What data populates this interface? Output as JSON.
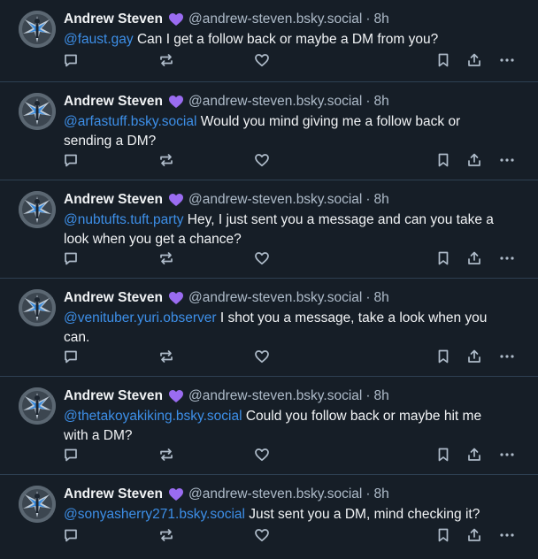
{
  "colors": {
    "background": "#161e27",
    "divider": "#2e4052",
    "mention": "#3d8fe8",
    "muted": "#aebbc9",
    "badge": "#9a6cf1"
  },
  "icons": [
    "reply-icon",
    "repost-icon",
    "like-icon",
    "bookmark-icon",
    "share-icon",
    "more-icon"
  ],
  "posts": [
    {
      "author": "Andrew Steven",
      "handle": "@andrew-steven.bsky.social",
      "separator": "·",
      "time": "8h",
      "mention": "@faust.gay",
      "body": " Can I get a follow back or maybe a DM from you?"
    },
    {
      "author": "Andrew Steven",
      "handle": "@andrew-steven.bsky.social",
      "separator": "·",
      "time": "8h",
      "mention": "@arfastuff.bsky.social",
      "body": " Would you mind giving me a follow back or sending a DM?"
    },
    {
      "author": "Andrew Steven",
      "handle": "@andrew-steven.bsky.social",
      "separator": "·",
      "time": "8h",
      "mention": "@nubtufts.tuft.party",
      "body": " Hey, I just sent you a message and can you take a look when you get a chance?"
    },
    {
      "author": "Andrew Steven",
      "handle": "@andrew-steven.bsky.social",
      "separator": "·",
      "time": "8h",
      "mention": "@venituber.yuri.observer",
      "body": " I shot you a message, take a look when you can."
    },
    {
      "author": "Andrew Steven",
      "handle": "@andrew-steven.bsky.social",
      "separator": "·",
      "time": "8h",
      "mention": "@thetakoyakiking.bsky.social",
      "body": " Could you follow back or maybe hit me with a DM?"
    },
    {
      "author": "Andrew Steven",
      "handle": "@andrew-steven.bsky.social",
      "separator": "·",
      "time": "8h",
      "mention": "@sonyasherry271.bsky.social",
      "body": " Just sent you a DM, mind checking it?"
    }
  ]
}
